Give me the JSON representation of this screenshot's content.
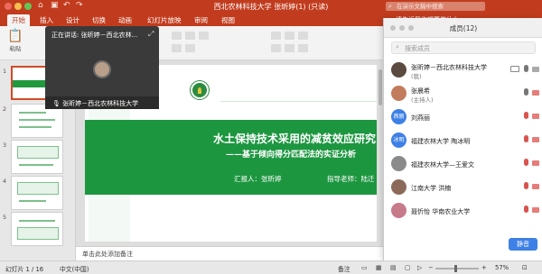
{
  "window": {
    "title": "西北农林科技大学 张昕婷(1) (只读)",
    "search_placeholder": "在演示文稿中搜索",
    "tell_me": "请告诉我你想要做什么"
  },
  "ribbon_tabs": [
    "开始",
    "插入",
    "设计",
    "切换",
    "动画",
    "幻灯片放映",
    "审阅",
    "视图"
  ],
  "ribbon": {
    "paste_label": "粘贴"
  },
  "video": {
    "now_speaking": "正在讲话: 张昕婷－西北农林...",
    "speaker_name": "张昕婷－西北农林科技大学"
  },
  "slide_numbers": [
    "1",
    "2",
    "3",
    "4",
    "5"
  ],
  "slide": {
    "title": "水土保持技术采用的减贫效应研究",
    "subtitle": "——基于倾向得分匹配法的实证分析",
    "reporter": "汇报人：张昕婷",
    "advisor": "指导老师：陆迁"
  },
  "notes_placeholder": "单击此处添加备注",
  "members_panel": {
    "title": "成员(12)",
    "search_placeholder": "搜索成员",
    "members": [
      {
        "name": "张昕婷－西北农林科技大学",
        "role": "(我)",
        "avatar_text": "",
        "avatar_color": "#5a4a40",
        "sharing": true,
        "mic_muted": false,
        "cam_muted": false
      },
      {
        "name": "张晨希",
        "role": "(主持人)",
        "avatar_text": "",
        "avatar_color": "#c27b5c",
        "sharing": false,
        "mic_muted": false,
        "cam_muted": true
      },
      {
        "name": "刘燕丽",
        "role": "",
        "avatar_text": "燕丽",
        "avatar_color": "#3d80e6",
        "sharing": false,
        "mic_muted": true,
        "cam_muted": true
      },
      {
        "name": "福建农林大学 陶冰明",
        "role": "",
        "avatar_text": "冰明",
        "avatar_color": "#3d80e6",
        "sharing": false,
        "mic_muted": true,
        "cam_muted": true
      },
      {
        "name": "福建农林大学—王爱文",
        "role": "",
        "avatar_text": "",
        "avatar_color": "#8a8a8a",
        "sharing": false,
        "mic_muted": true,
        "cam_muted": true
      },
      {
        "name": "江南大学 洪楠",
        "role": "",
        "avatar_text": "",
        "avatar_color": "#8c6a5a",
        "sharing": false,
        "mic_muted": true,
        "cam_muted": true
      },
      {
        "name": "聂忻怡 华南农业大学",
        "role": "",
        "avatar_text": "",
        "avatar_color": "#c77a8a",
        "sharing": false,
        "mic_muted": true,
        "cam_muted": true
      }
    ],
    "mute_all_label": "静音"
  },
  "statusbar": {
    "slide_position": "幻灯片 1 / 16",
    "language": "中文(中国)",
    "notes_label": "备注",
    "zoom": "57%"
  },
  "colors": {
    "accent": "#c13c1e",
    "slide_green": "#1d9640",
    "primary_blue": "#3d80e6"
  }
}
